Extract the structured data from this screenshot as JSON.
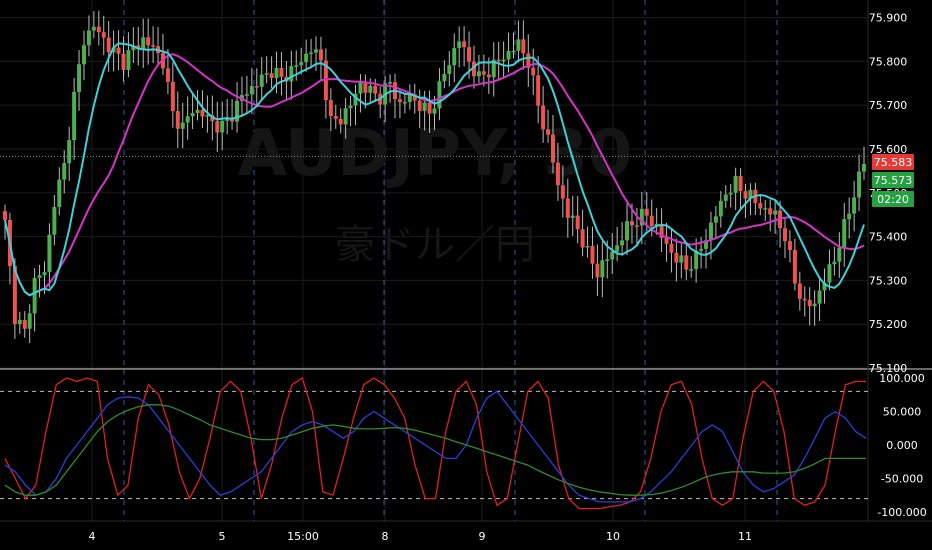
{
  "watermark": {
    "symbol": "AUDJPY, 30",
    "name": "豪ドル／円"
  },
  "colors": {
    "background": "#000000",
    "grid": "#1c1c1c",
    "session_line": "#2f5aa8",
    "up": "#4caf50",
    "down": "#ef5350",
    "wick": "#bdbdbd",
    "ma_fast": "#3fd0d8",
    "ma_slow": "#d633c9",
    "osc_red": "#e02020",
    "osc_blue": "#2a3fd6",
    "osc_green": "#2e8b2e",
    "axis_text": "#ffffff",
    "last_price_tag": "#e53935",
    "current_price_tag": "#26a040"
  },
  "chart_data": [
    {
      "type": "candlestick",
      "ylim": [
        75.1,
        75.94
      ],
      "price_ticks": [
        "75.100",
        "75.200",
        "75.300",
        "75.400",
        "75.500",
        "75.600",
        "75.700",
        "75.800",
        "75.900"
      ],
      "x_ticks": [
        "4",
        "5",
        "15:00",
        "8",
        "9",
        "10",
        "11"
      ],
      "last_price": "75.583",
      "current_price": "75.573",
      "countdown": "02:20",
      "ohlc_anchor": [
        [
          0,
          75.43
        ],
        [
          2,
          75.22
        ],
        [
          4,
          75.18
        ],
        [
          6,
          75.3
        ],
        [
          8,
          75.32
        ],
        [
          10,
          75.48
        ],
        [
          12,
          75.56
        ],
        [
          14,
          75.72
        ],
        [
          16,
          75.85
        ],
        [
          18,
          75.88
        ],
        [
          20,
          75.85
        ],
        [
          22,
          75.82
        ],
        [
          24,
          75.8
        ],
        [
          26,
          75.83
        ],
        [
          28,
          75.85
        ],
        [
          30,
          75.83
        ],
        [
          32,
          75.8
        ],
        [
          34,
          75.68
        ],
        [
          36,
          75.65
        ],
        [
          38,
          75.69
        ],
        [
          40,
          75.68
        ],
        [
          42,
          75.66
        ],
        [
          44,
          75.65
        ],
        [
          46,
          75.68
        ],
        [
          48,
          75.72
        ],
        [
          50,
          75.74
        ],
        [
          52,
          75.76
        ],
        [
          54,
          75.78
        ],
        [
          56,
          75.76
        ],
        [
          58,
          75.78
        ],
        [
          60,
          75.8
        ],
        [
          62,
          75.83
        ],
        [
          64,
          75.8
        ],
        [
          66,
          75.66
        ],
        [
          68,
          75.67
        ],
        [
          70,
          75.7
        ],
        [
          72,
          75.75
        ],
        [
          74,
          75.73
        ],
        [
          76,
          75.72
        ],
        [
          78,
          75.75
        ],
        [
          80,
          75.7
        ],
        [
          82,
          75.72
        ],
        [
          84,
          75.7
        ],
        [
          86,
          75.68
        ],
        [
          88,
          75.74
        ],
        [
          90,
          75.8
        ],
        [
          92,
          75.85
        ],
        [
          94,
          75.8
        ],
        [
          96,
          75.76
        ],
        [
          98,
          75.78
        ],
        [
          100,
          75.8
        ],
        [
          102,
          75.82
        ],
        [
          104,
          75.84
        ],
        [
          106,
          75.8
        ],
        [
          108,
          75.7
        ],
        [
          110,
          75.62
        ],
        [
          112,
          75.52
        ],
        [
          114,
          75.45
        ],
        [
          116,
          75.42
        ],
        [
          118,
          75.36
        ],
        [
          120,
          75.32
        ],
        [
          122,
          75.35
        ],
        [
          124,
          75.38
        ],
        [
          126,
          75.42
        ],
        [
          128,
          75.44
        ],
        [
          130,
          75.45
        ],
        [
          132,
          75.42
        ],
        [
          134,
          75.38
        ],
        [
          136,
          75.35
        ],
        [
          138,
          75.33
        ],
        [
          140,
          75.35
        ],
        [
          142,
          75.4
        ],
        [
          144,
          75.45
        ],
        [
          146,
          75.5
        ],
        [
          148,
          75.52
        ],
        [
          150,
          75.5
        ],
        [
          152,
          75.48
        ],
        [
          154,
          75.46
        ],
        [
          156,
          75.45
        ],
        [
          158,
          75.4
        ],
        [
          160,
          75.3
        ],
        [
          162,
          75.24
        ],
        [
          164,
          75.25
        ],
        [
          166,
          75.3
        ],
        [
          168,
          75.35
        ],
        [
          170,
          75.42
        ],
        [
          172,
          75.5
        ],
        [
          174,
          75.57
        ]
      ],
      "series": [
        {
          "name": "",
          "color_key": "ma_fast",
          "kind": "moving-average",
          "period": "fast"
        },
        {
          "name": "",
          "color_key": "ma_slow",
          "kind": "moving-average",
          "period": "slow"
        }
      ]
    },
    {
      "type": "line",
      "ylim": [
        -112,
        112
      ],
      "y_ticks": [
        "100.000",
        "50.000",
        "0.000",
        "-50.000",
        "-100.000"
      ],
      "levels": [
        80,
        -80
      ],
      "series": [
        {
          "name": "",
          "color_key": "osc_red",
          "values": [
            -20,
            -50,
            -80,
            -60,
            20,
            90,
            100,
            95,
            100,
            95,
            -20,
            -75,
            -60,
            40,
            90,
            75,
            30,
            -40,
            -80,
            -50,
            10,
            80,
            95,
            80,
            10,
            -80,
            -30,
            40,
            90,
            100,
            50,
            -70,
            -75,
            -20,
            40,
            90,
            100,
            90,
            70,
            40,
            -30,
            -80,
            -80,
            20,
            80,
            95,
            60,
            -40,
            -90,
            -80,
            0,
            80,
            95,
            70,
            -30,
            -80,
            -95,
            -95,
            -95,
            -92,
            -90,
            -85,
            -70,
            -20,
            50,
            90,
            95,
            60,
            -20,
            -80,
            -90,
            -80,
            10,
            80,
            95,
            80,
            20,
            -80,
            -90,
            -85,
            -60,
            20,
            90,
            95,
            95
          ]
        },
        {
          "name": "",
          "color_key": "osc_blue",
          "values": [
            -30,
            -40,
            -60,
            -75,
            -70,
            -50,
            -20,
            0,
            20,
            40,
            60,
            70,
            72,
            70,
            60,
            40,
            20,
            0,
            -20,
            -40,
            -60,
            -75,
            -70,
            -60,
            -50,
            -40,
            -20,
            0,
            20,
            30,
            35,
            30,
            20,
            10,
            20,
            40,
            50,
            40,
            30,
            20,
            10,
            0,
            -10,
            -20,
            -20,
            0,
            40,
            70,
            80,
            60,
            40,
            20,
            0,
            -20,
            -40,
            -60,
            -75,
            -80,
            -85,
            -85,
            -85,
            -85,
            -80,
            -70,
            -55,
            -40,
            -20,
            0,
            20,
            30,
            20,
            -10,
            -40,
            -60,
            -70,
            -65,
            -55,
            -45,
            -20,
            10,
            40,
            50,
            40,
            20,
            10
          ]
        },
        {
          "name": "",
          "color_key": "osc_green",
          "values": [
            -60,
            -70,
            -75,
            -75,
            -70,
            -60,
            -40,
            -20,
            0,
            20,
            35,
            45,
            52,
            57,
            60,
            60,
            58,
            52,
            45,
            38,
            30,
            25,
            20,
            15,
            10,
            8,
            8,
            10,
            15,
            20,
            25,
            28,
            30,
            28,
            25,
            24,
            24,
            25,
            26,
            25,
            22,
            18,
            14,
            10,
            5,
            0,
            -5,
            -10,
            -15,
            -20,
            -25,
            -30,
            -38,
            -45,
            -52,
            -58,
            -63,
            -67,
            -70,
            -72,
            -74,
            -75,
            -75,
            -74,
            -72,
            -68,
            -63,
            -57,
            -50,
            -45,
            -42,
            -40,
            -40,
            -40,
            -42,
            -42,
            -42,
            -40,
            -35,
            -28,
            -20,
            -20,
            -20,
            -20,
            -20
          ]
        }
      ]
    }
  ]
}
